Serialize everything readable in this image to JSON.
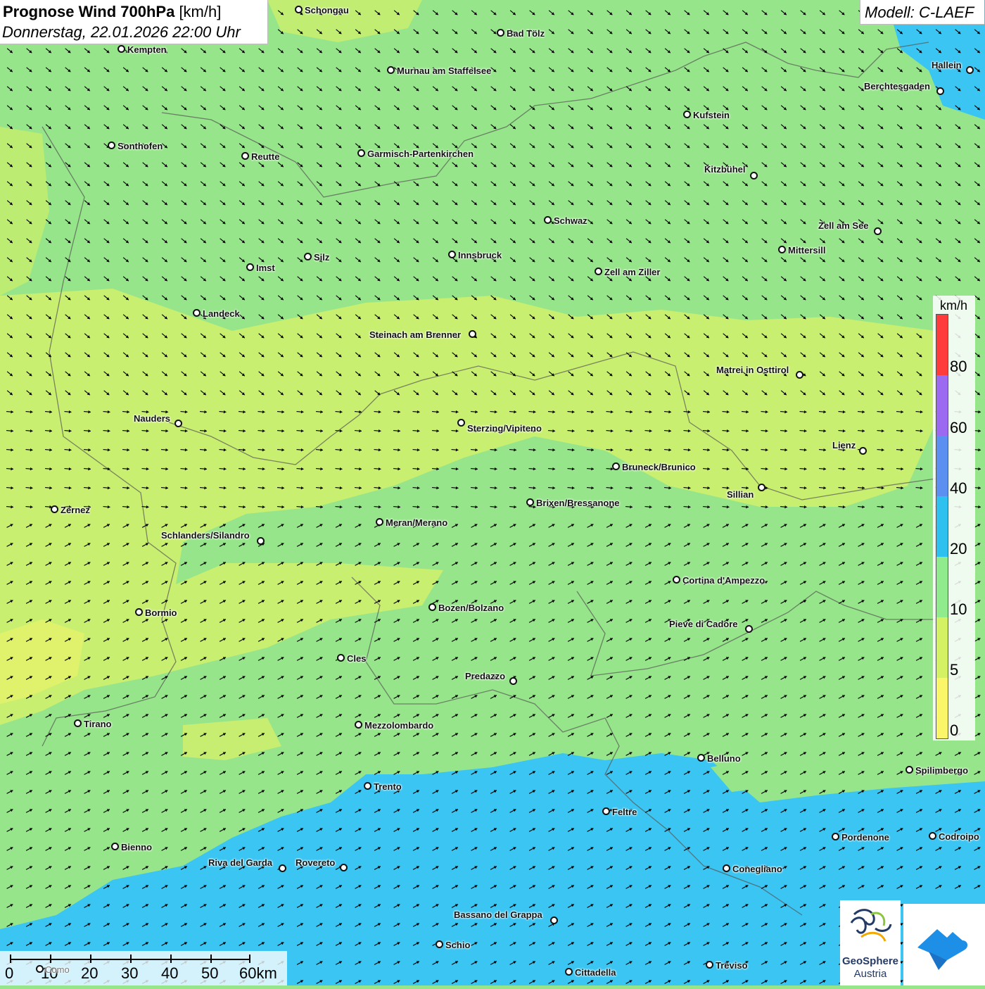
{
  "header": {
    "title_bold": "Prognose Wind 700hPa",
    "title_unit": "[km/h]",
    "datetime": "Donnerstag, 22.01.2026 22:00 Uhr"
  },
  "model": {
    "label": "Modell: C-LAEF"
  },
  "legend": {
    "unit": "km/h",
    "ticks": [
      "80",
      "60",
      "40",
      "20",
      "10",
      "5",
      "0"
    ],
    "colors": [
      "#ff3b3b",
      "#9b6af0",
      "#5b8ff0",
      "#2ec0ef",
      "#8feb8c",
      "#d3f162",
      "#fbf56a"
    ]
  },
  "scale_bar": {
    "labels": [
      "0",
      "10",
      "20",
      "30",
      "40",
      "50",
      "60km"
    ]
  },
  "logos": {
    "geosphere_line1": "GeoSphere",
    "geosphere_line2": "Austria",
    "geosphere_icon": "geosphere-swirl-icon",
    "app_icon": "cloud-arrow-icon"
  },
  "map": {
    "colors": {
      "calm_yellow": "#d8f06a",
      "light_green": "#96e58a",
      "blue": "#38c4f2"
    },
    "wind_direction": "east-southeast (north), east-northeast (south)",
    "cities": [
      {
        "name": "Schongau"
      },
      {
        "name": "Bad Tölz"
      },
      {
        "name": "Kempten"
      },
      {
        "name": "Murnau am Staffelsee"
      },
      {
        "name": "Hallein"
      },
      {
        "name": "Berchtesgaden"
      },
      {
        "name": "Kufstein"
      },
      {
        "name": "Sonthofen"
      },
      {
        "name": "Reutte"
      },
      {
        "name": "Garmisch-Partenkirchen"
      },
      {
        "name": "Kitzbühel"
      },
      {
        "name": "Schwaz"
      },
      {
        "name": "Zell am See"
      },
      {
        "name": "Innsbruck"
      },
      {
        "name": "Mittersill"
      },
      {
        "name": "Silz"
      },
      {
        "name": "Imst"
      },
      {
        "name": "Zell am Ziller"
      },
      {
        "name": "Landeck"
      },
      {
        "name": "Steinach am Brenner"
      },
      {
        "name": "Matrei in Osttirol"
      },
      {
        "name": "Nauders"
      },
      {
        "name": "Sterzing/Vipiteno"
      },
      {
        "name": "Lienz"
      },
      {
        "name": "Bruneck/Brunico"
      },
      {
        "name": "Sillian"
      },
      {
        "name": "Zernez"
      },
      {
        "name": "Brixen/Bressanone"
      },
      {
        "name": "Meran/Merano"
      },
      {
        "name": "Schlanders/Silandro"
      },
      {
        "name": "Cortina d'Ampezzo"
      },
      {
        "name": "Bozen/Bolzano"
      },
      {
        "name": "Bormio"
      },
      {
        "name": "Pieve di Cadore"
      },
      {
        "name": "Cles"
      },
      {
        "name": "Predazzo"
      },
      {
        "name": "Tirano"
      },
      {
        "name": "Mezzolombardo"
      },
      {
        "name": "Belluno"
      },
      {
        "name": "Spilimbergo"
      },
      {
        "name": "Trento"
      },
      {
        "name": "Feltre"
      },
      {
        "name": "Bienno"
      },
      {
        "name": "Pordenone"
      },
      {
        "name": "Codroipo"
      },
      {
        "name": "Riva del Garda"
      },
      {
        "name": "Rovereto"
      },
      {
        "name": "Conegliano"
      },
      {
        "name": "Bassano del Grappa"
      },
      {
        "name": "Schio"
      },
      {
        "name": "Treviso"
      },
      {
        "name": "Cittadella"
      },
      {
        "name": "Como"
      }
    ]
  }
}
